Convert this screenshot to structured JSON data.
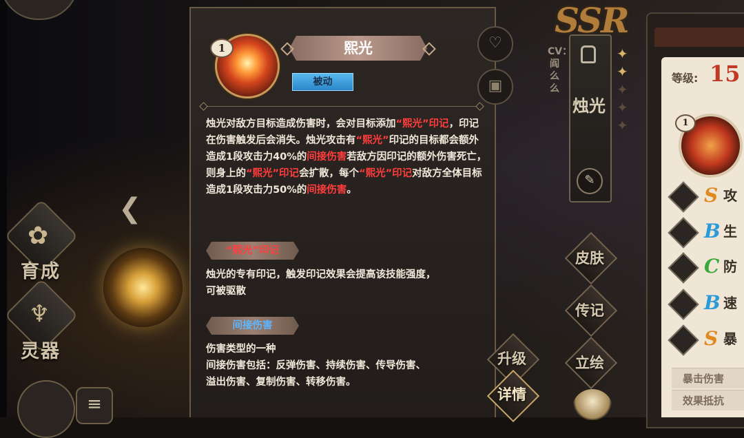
{
  "left": {
    "nav_cultivate": "育成",
    "nav_artifact": "灵器"
  },
  "skill": {
    "level": "1",
    "name": "熙光",
    "type_tag": "被动",
    "description_parts": [
      {
        "text": "烛光对敌方目标造成伤害时，会对目标添加",
        "hl": false
      },
      {
        "text": "“熙光”印记",
        "hl": true
      },
      {
        "text": "，印记在伤害触发后会消失。烛光攻击有",
        "hl": false
      },
      {
        "text": "“熙光”",
        "hl": true
      },
      {
        "text": "印记的目标都会额外造成1段攻击力40%的",
        "hl": false
      },
      {
        "text": "间接伤害",
        "hl": true
      },
      {
        "text": "若敌方因印记的额外伤害死亡，则身上的",
        "hl": false
      },
      {
        "text": "“熙光”印记",
        "hl": true
      },
      {
        "text": "会扩散，每个",
        "hl": false
      },
      {
        "text": "“熙光”印记",
        "hl": true
      },
      {
        "text": "对敌方全体目标造成1段攻击力50%的",
        "hl": false
      },
      {
        "text": "间接伤害",
        "hl": true
      },
      {
        "text": "。",
        "hl": false
      }
    ],
    "mark_title": "“熙光”印记",
    "mark_desc_line1": "烛光的专有印记，触发印记效果会提高该技能强度，",
    "mark_desc_line2": "可被驱散",
    "indirect_title": "间接伤害",
    "indirect_line1": "伤害类型的一种",
    "indirect_line2": "间接伤害包括：反弹伤害、持续伤害、传导伤害、",
    "indirect_line3": "溢出伤害、复制伤害、转移伤害。"
  },
  "character": {
    "rarity": "SSR",
    "cv_label": "CV：阎么么",
    "name": "烛光",
    "btn_skin": "皮肤",
    "btn_bio": "传记",
    "btn_art": "立绘",
    "btn_upgrade": "升级",
    "btn_detail": "详情"
  },
  "card": {
    "level_label": "等级:",
    "level_value": "15",
    "skill_level": "1",
    "stats": [
      {
        "grade": "S",
        "name": "攻",
        "color": "#e08a1e"
      },
      {
        "grade": "B",
        "name": "生",
        "color": "#2a9ad8"
      },
      {
        "grade": "C",
        "name": "防",
        "color": "#3aa83a"
      },
      {
        "grade": "B",
        "name": "速",
        "color": "#2a9ad8"
      },
      {
        "grade": "S",
        "name": "暴",
        "color": "#e08a1e"
      }
    ],
    "crit_damage": "暴击伤害",
    "effect_resist": "效果抵抗"
  }
}
